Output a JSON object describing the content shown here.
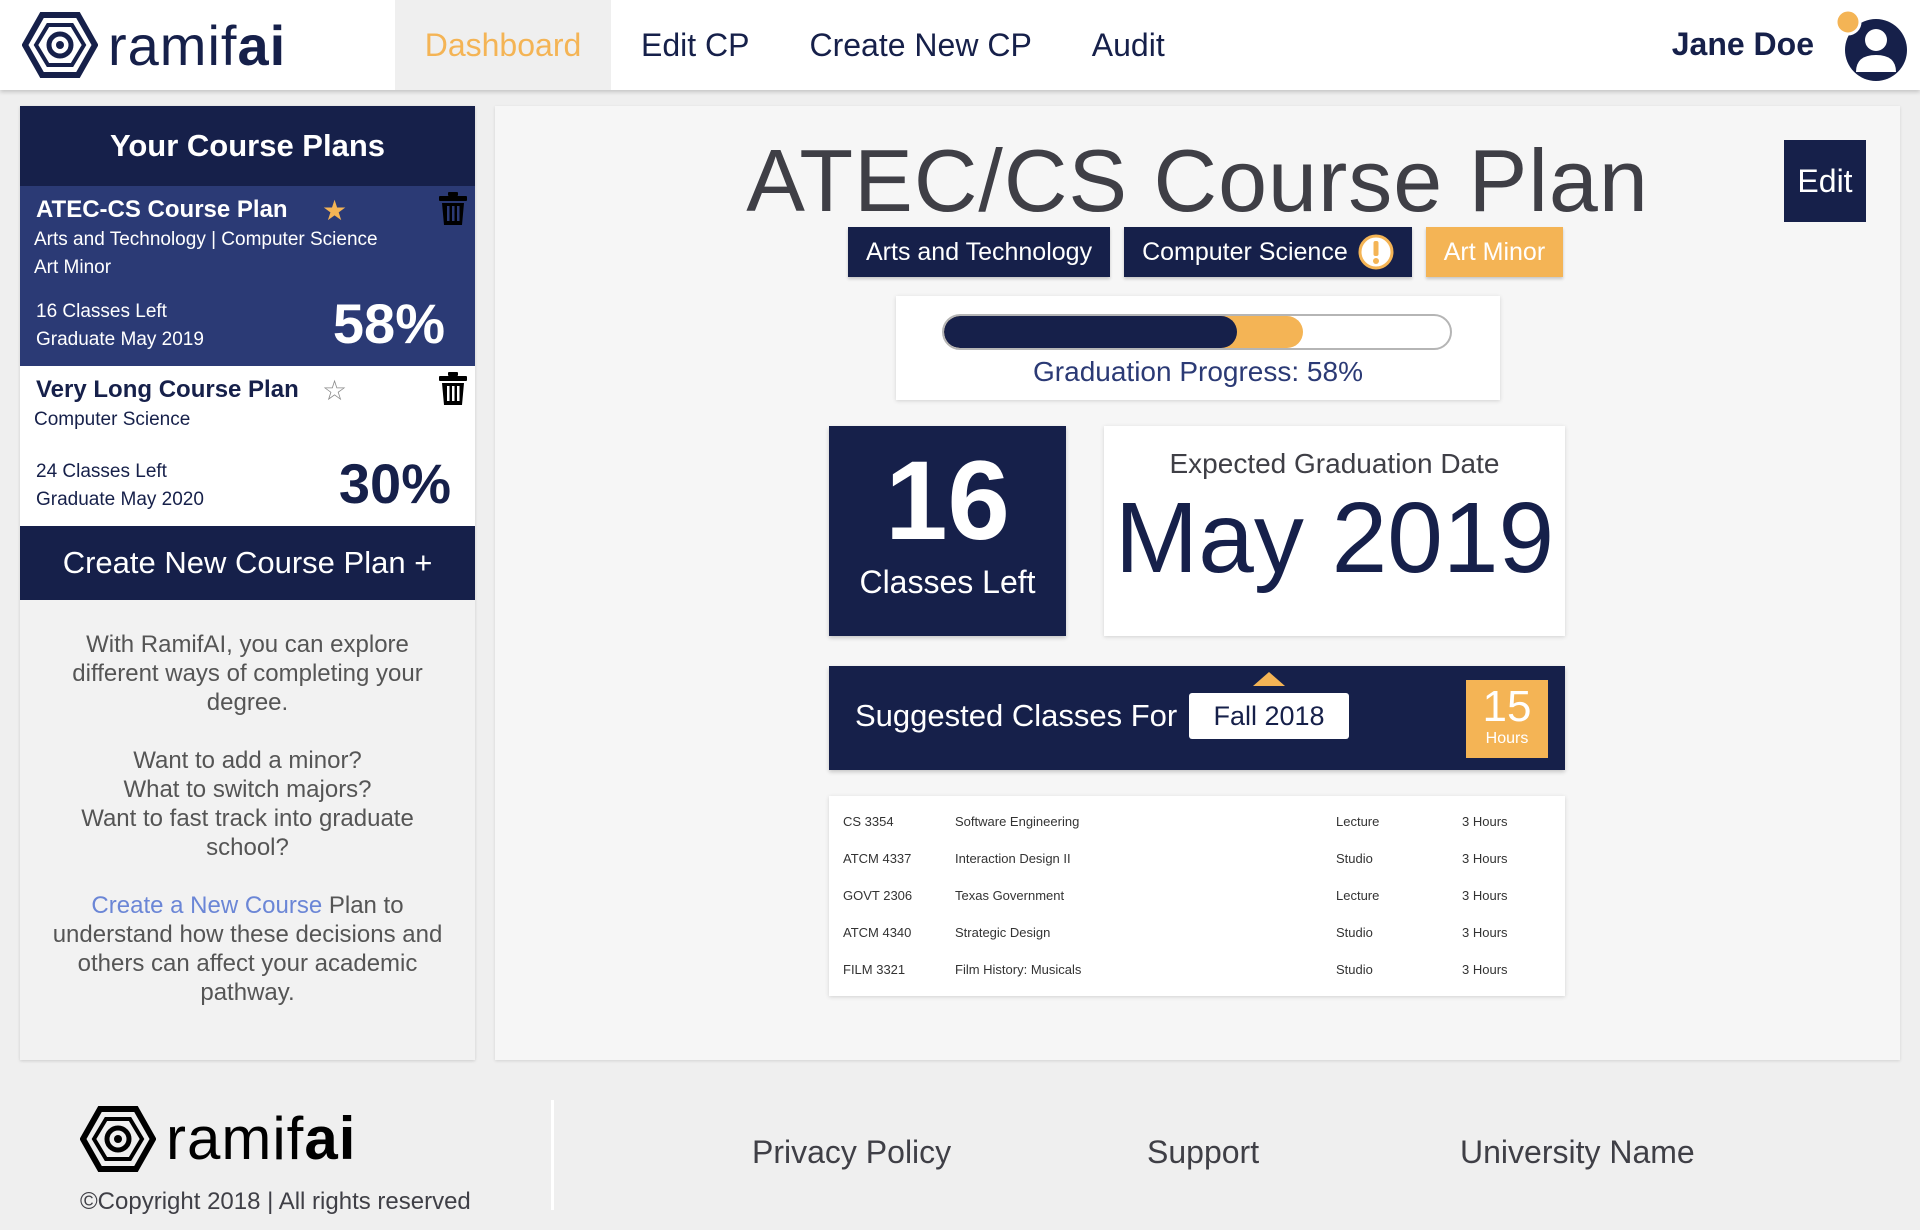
{
  "brand": {
    "name_light": "ramif",
    "name_bold": "ai"
  },
  "header": {
    "nav": [
      "Dashboard",
      "Edit CP",
      "Create New CP",
      "Audit"
    ],
    "user_name": "Jane Doe"
  },
  "sidebar": {
    "title": "Your Course Plans",
    "plans": [
      {
        "name": "ATEC-CS Course Plan",
        "majors": "Arts and Technology | Computer Science",
        "minor": "Art Minor",
        "classes_left": "16 Classes Left",
        "graduate": "Graduate May 2019",
        "percent": "58%",
        "starred": true,
        "star": "★"
      },
      {
        "name": "Very Long Course Plan",
        "majors": "Computer Science",
        "minor": "",
        "classes_left": "24 Classes Left",
        "graduate": "Graduate May 2020",
        "percent": "30%",
        "starred": false,
        "star": "☆"
      }
    ],
    "create_button": "Create New Course Plan +",
    "info": {
      "p1": "With RamifAI, you can explore different ways of completing your degree.",
      "p2_line1": "Want to add a minor?",
      "p2_line2": "What to switch majors?",
      "p2_line3": "Want to fast track into graduate school?",
      "p3_link": "Create a New Course",
      "p3_rest": " Plan to understand how these decisions and others can affect your academic pathway."
    }
  },
  "main": {
    "title": "ATEC/CS Course Plan",
    "edit_label": "Edit",
    "tags": [
      {
        "label": "Arts and Technology",
        "kind": "major"
      },
      {
        "label": "Computer Science",
        "kind": "major",
        "warning": true
      },
      {
        "label": "Art Minor",
        "kind": "minor"
      }
    ],
    "progress": {
      "label": "Graduation Progress: 58%",
      "completed_fraction": 0.58,
      "planned_fraction": 0.71
    },
    "classes_left": {
      "value": "16",
      "label": "Classes Left"
    },
    "graduation": {
      "label": "Expected Graduation Date",
      "value": "May 2019"
    },
    "suggested": {
      "label": "Suggested Classes For",
      "term": "Fall 2018",
      "hours": "15",
      "hours_label": "Hours"
    },
    "courses": [
      {
        "code": "CS 3354",
        "name": "Software Engineering",
        "type": "Lecture",
        "hours": "3 Hours"
      },
      {
        "code": "ATCM 4337",
        "name": "Interaction Design II",
        "type": "Studio",
        "hours": "3 Hours"
      },
      {
        "code": "GOVT 2306",
        "name": "Texas Government",
        "type": "Lecture",
        "hours": "3 Hours"
      },
      {
        "code": "ATCM 4340",
        "name": "Strategic Design",
        "type": "Studio",
        "hours": "3 Hours"
      },
      {
        "code": "FILM 3321",
        "name": "Film History: Musicals",
        "type": "Studio",
        "hours": "3 Hours"
      }
    ]
  },
  "footer": {
    "copyright": "©Copyright 2018 | All rights reserved",
    "links": [
      "Privacy Policy",
      "Support",
      "University Name"
    ]
  },
  "colors": {
    "navy": "#16204a",
    "navy_light": "#2b3a75",
    "gold": "#f4b455",
    "link": "#6b86d6",
    "bg": "#efefef"
  },
  "icons": [
    "ramifai-logo-icon",
    "user-avatar-icon",
    "star-icon",
    "trash-icon",
    "warning-icon",
    "caret-up-icon"
  ]
}
